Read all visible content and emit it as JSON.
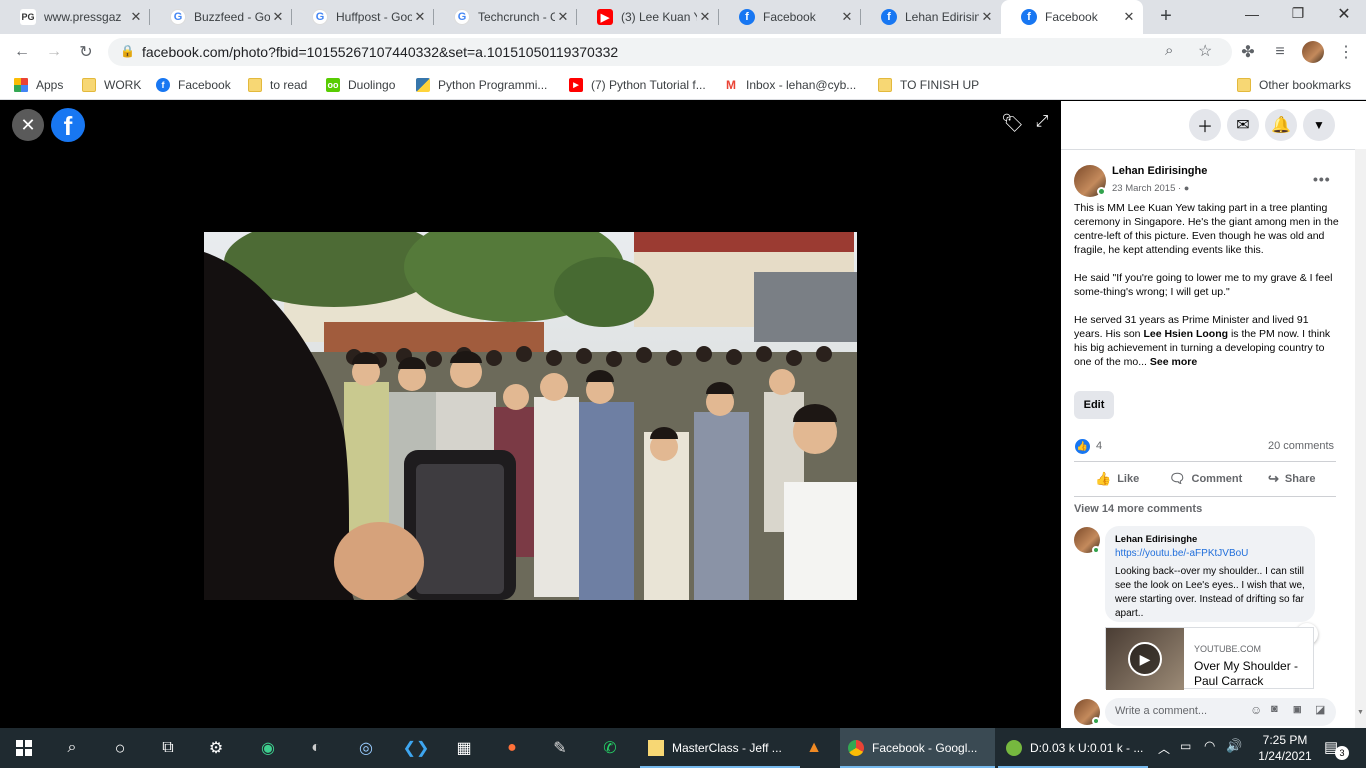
{
  "browser": {
    "tabs": [
      {
        "title": "www.pressgaz",
        "favicon": "PG"
      },
      {
        "title": "Buzzfeed - Go",
        "favicon": "G"
      },
      {
        "title": "Huffpost - Goo",
        "favicon": "G"
      },
      {
        "title": "Techcrunch - G",
        "favicon": "G"
      },
      {
        "title": "(3) Lee Kuan Y",
        "favicon": "youtube-icon"
      },
      {
        "title": "Facebook",
        "favicon": "f"
      },
      {
        "title": "Lehan Edirising",
        "favicon": "f"
      },
      {
        "title": "Facebook",
        "favicon": "f",
        "active": true
      }
    ],
    "url": "facebook.com/photo?fbid=10155267107440332&set=a.10151050119370332",
    "bookmarks": [
      {
        "label": "Apps",
        "icon": "apps-grid-icon"
      },
      {
        "label": "WORK",
        "icon": "folder-icon"
      },
      {
        "label": "Facebook",
        "icon": "facebook-icon"
      },
      {
        "label": "to read",
        "icon": "folder-icon"
      },
      {
        "label": "Duolingo",
        "icon": "duolingo-icon"
      },
      {
        "label": "Python Programmi...",
        "icon": "python-icon"
      },
      {
        "label": "(7) Python Tutorial f...",
        "icon": "youtube-icon"
      },
      {
        "label": "Inbox - lehan@cyb...",
        "icon": "gmail-icon"
      },
      {
        "label": "TO FINISH UP",
        "icon": "folder-icon"
      }
    ],
    "other_bookmarks": "Other bookmarks"
  },
  "post": {
    "author": "Lehan Edirisinghe",
    "date": "23 March 2015 ·",
    "paragraphs": [
      "This is MM Lee Kuan Yew taking part in a tree planting ceremony in Singapore. He's the giant among men in the centre-left of this picture. Even though he was old and fragile, he kept attending events like this.",
      "He said \"If you're going to lower me to my grave & I feel some-thing's wrong; I will get up.\""
    ],
    "para3_before": "He served 31 years as Prime Minister and lived 91 years. His son ",
    "para3_bold": "Lee Hsien Loong",
    "para3_after": " is the PM now. I think his big achievement in turning a developing country to one of the mo...",
    "see_more": "See more",
    "edit": "Edit",
    "likes": "4",
    "comments_count": "20 comments",
    "actions": {
      "like": "Like",
      "comment": "Comment",
      "share": "Share"
    },
    "view_more": "View 14 more comments"
  },
  "comment": {
    "author": "Lehan Edirisinghe",
    "link": "https://youtu.be/-aFPKtJVBoU",
    "text": "Looking back--over my shoulder.. I can still see the look on Lee's eyes.. I wish that we, were starting over. Instead of drifting so far apart..",
    "preview": {
      "source": "YOUTUBE.COM",
      "title": "Over My Shoulder - Paul Carrack"
    }
  },
  "write_placeholder": "Write a comment...",
  "taskbar": {
    "apps": [
      {
        "label": "MasterClass - Jeff ..."
      },
      {
        "label": "Facebook - Googl..."
      },
      {
        "label": "D:0.03 k U:0.01 k - ..."
      }
    ],
    "time": "7:25 PM",
    "date": "1/24/2021",
    "notifications": "3"
  }
}
